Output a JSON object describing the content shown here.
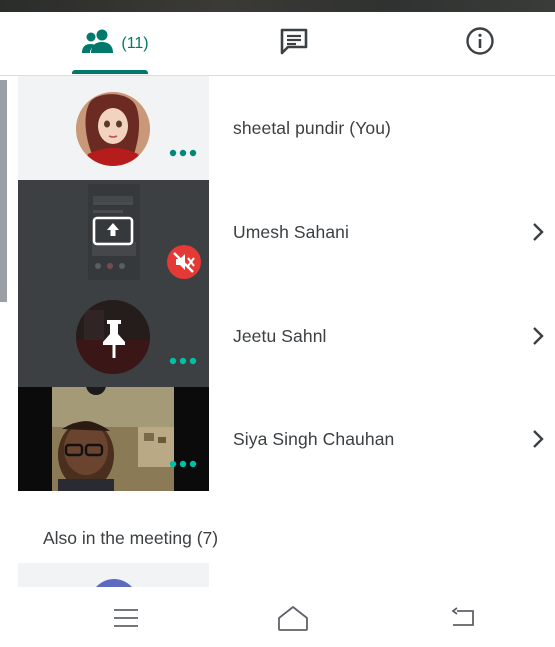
{
  "tabs": {
    "people": {
      "icon": "people-icon",
      "count": "(11)"
    },
    "chat": {
      "icon": "chat-icon"
    },
    "info": {
      "icon": "info-icon"
    }
  },
  "participants": [
    {
      "name": "sheetal pundir (You)",
      "tile": "avatar-photo",
      "menu": "more-dots-icon"
    },
    {
      "name": "Umesh Sahani",
      "tile": "screen-share",
      "status": "muted-icon"
    },
    {
      "name": "Jeetu Sahnl",
      "tile": "pinned-avatar",
      "menu": "more-dots-icon"
    },
    {
      "name": "Siya Singh Chauhan",
      "tile": "video",
      "menu": "more-dots-icon"
    }
  ],
  "also_in_meeting": {
    "label": "Also in the meeting (7)"
  },
  "navbar": {
    "items": [
      "menu-icon",
      "home-icon",
      "back-icon"
    ]
  },
  "colors": {
    "accent": "#00796b",
    "muted_badge": "#e53935",
    "text": "#3c4043",
    "divider": "#dadce0"
  }
}
